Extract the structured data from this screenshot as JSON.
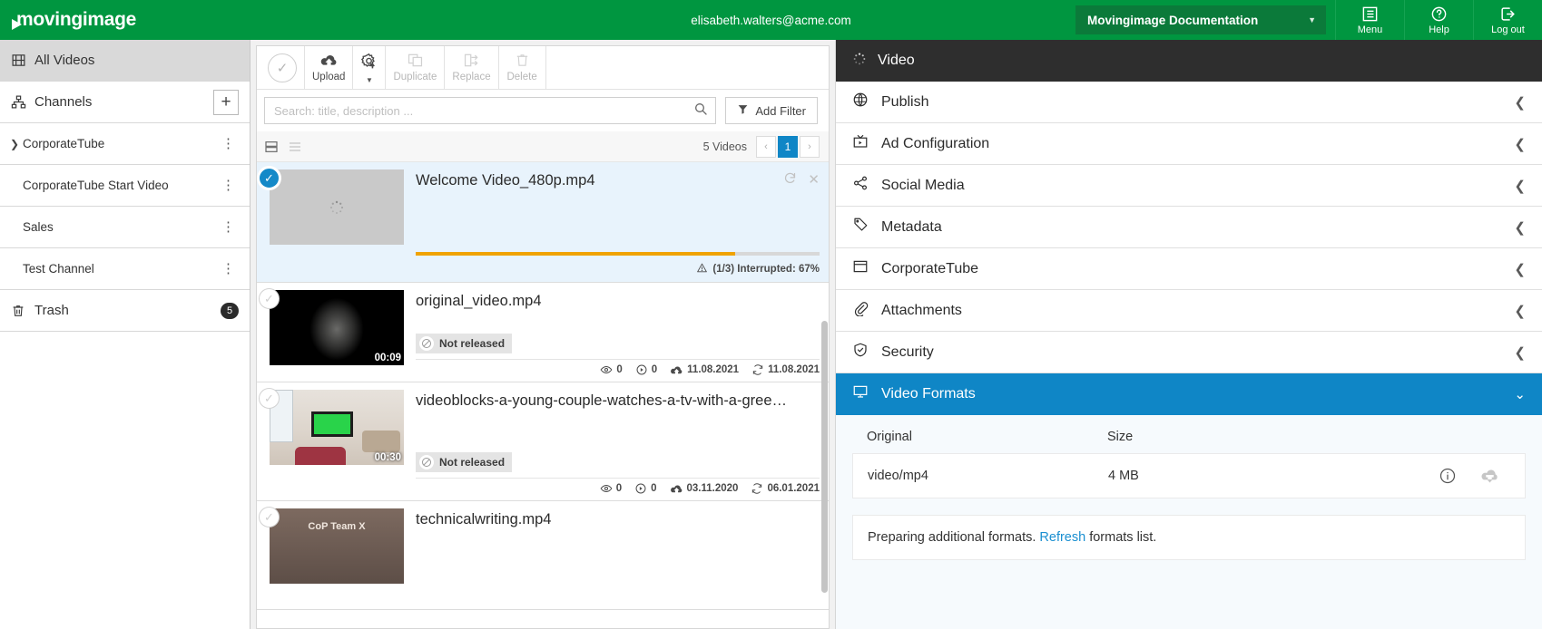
{
  "header": {
    "brand": "movingimage",
    "user_email": "elisabeth.walters@acme.com",
    "tenant": "Movingimage Documentation",
    "caret": "▼",
    "buttons": [
      {
        "label": "Menu",
        "icon": "menu-list-icon"
      },
      {
        "label": "Help",
        "icon": "question-circle-icon"
      },
      {
        "label": "Log out",
        "icon": "logout-icon"
      }
    ],
    "accent": "#009640"
  },
  "sidebar": {
    "all_videos": "All Videos",
    "channels": "Channels",
    "add_channel": "+",
    "items": [
      {
        "label": "CorporateTube",
        "expandable": true
      },
      {
        "label": "CorporateTube Start Video",
        "expandable": false
      },
      {
        "label": "Sales",
        "expandable": false
      },
      {
        "label": "Test Channel",
        "expandable": false
      }
    ],
    "trash": "Trash",
    "trash_count": "5"
  },
  "toolbar": {
    "select_all": "select-all",
    "upload": "Upload",
    "duplicate": "Duplicate",
    "replace": "Replace",
    "delete": "Delete"
  },
  "search": {
    "value": "",
    "placeholder": "Search: title, description ...",
    "add_filter": "Add Filter"
  },
  "list_controls": {
    "count": "5 Videos",
    "page": "1",
    "prev": "‹",
    "next": "›"
  },
  "videos": [
    {
      "title": "Welcome Video_480p.mp4",
      "selected": true,
      "duration": "",
      "uploading": true,
      "progress_percent": 67,
      "status": "(1/3) Interrupted: 67%",
      "refresh_icon": "refresh-icon",
      "close_icon": "close-icon"
    },
    {
      "title": "original_video.mp4",
      "selected": false,
      "duration": "00:09",
      "release": "Not released",
      "views": "0",
      "plays": "0",
      "uploaded": "11.08.2021",
      "updated": "11.08.2021"
    },
    {
      "title": "videoblocks-a-young-couple-watches-a-tv-with-a-gree…",
      "selected": false,
      "duration": "00:30",
      "release": "Not released",
      "views": "0",
      "plays": "0",
      "uploaded": "03.11.2020",
      "updated": "06.01.2021"
    },
    {
      "title": "technicalwriting.mp4",
      "selected": false,
      "duration": "",
      "release": "",
      "views": "",
      "plays": "",
      "uploaded": "",
      "updated": "",
      "thumb_text": "CoP Team X"
    }
  ],
  "right_panel": {
    "title": "Video",
    "sections": [
      {
        "label": "Publish",
        "icon": "globe-icon",
        "open": false
      },
      {
        "label": "Ad Configuration",
        "icon": "tv-icon",
        "open": false
      },
      {
        "label": "Social Media",
        "icon": "share-icon",
        "open": false
      },
      {
        "label": "Metadata",
        "icon": "tag-icon",
        "open": false
      },
      {
        "label": "CorporateTube",
        "icon": "window-icon",
        "open": false
      },
      {
        "label": "Attachments",
        "icon": "paperclip-icon",
        "open": false
      },
      {
        "label": "Security",
        "icon": "shield-icon",
        "open": false
      },
      {
        "label": "Video Formats",
        "icon": "monitor-icon",
        "open": true
      }
    ],
    "formats": {
      "col_original": "Original",
      "col_size": "Size",
      "rows": [
        {
          "format": "video/mp4",
          "size": "4 MB",
          "info_icon": "info-icon",
          "download_icon": "download-icon"
        }
      ],
      "note_before": "Preparing additional formats. ",
      "note_link": "Refresh",
      "note_after": " formats list."
    },
    "accent": "#0f86c6"
  }
}
